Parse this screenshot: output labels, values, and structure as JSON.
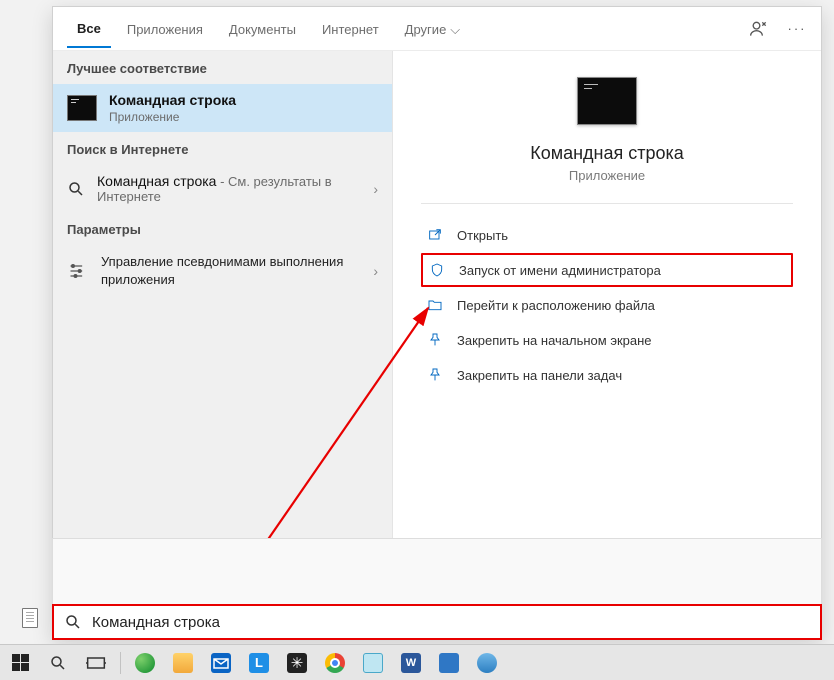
{
  "tabs": {
    "items": [
      "Все",
      "Приложения",
      "Документы",
      "Интернет",
      "Другие"
    ],
    "activeIndex": 0
  },
  "left": {
    "bestMatchLabel": "Лучшее соответствие",
    "bestMatch": {
      "title": "Командная строка",
      "sub": "Приложение"
    },
    "webLabel": "Поиск в Интернете",
    "webItem": {
      "title": "Командная строка",
      "sub": " - См. результаты в Интернете"
    },
    "settingsLabel": "Параметры",
    "settingsItem": "Управление псевдонимами выполнения приложения"
  },
  "preview": {
    "title": "Командная строка",
    "sub": "Приложение"
  },
  "actions": [
    {
      "label": "Открыть"
    },
    {
      "label": "Запуск от имени администратора",
      "highlight": true
    },
    {
      "label": "Перейти к расположению файла"
    },
    {
      "label": "Закрепить на начальном экране"
    },
    {
      "label": "Закрепить на панели задач"
    }
  ],
  "search": {
    "value": "Командная строка"
  }
}
